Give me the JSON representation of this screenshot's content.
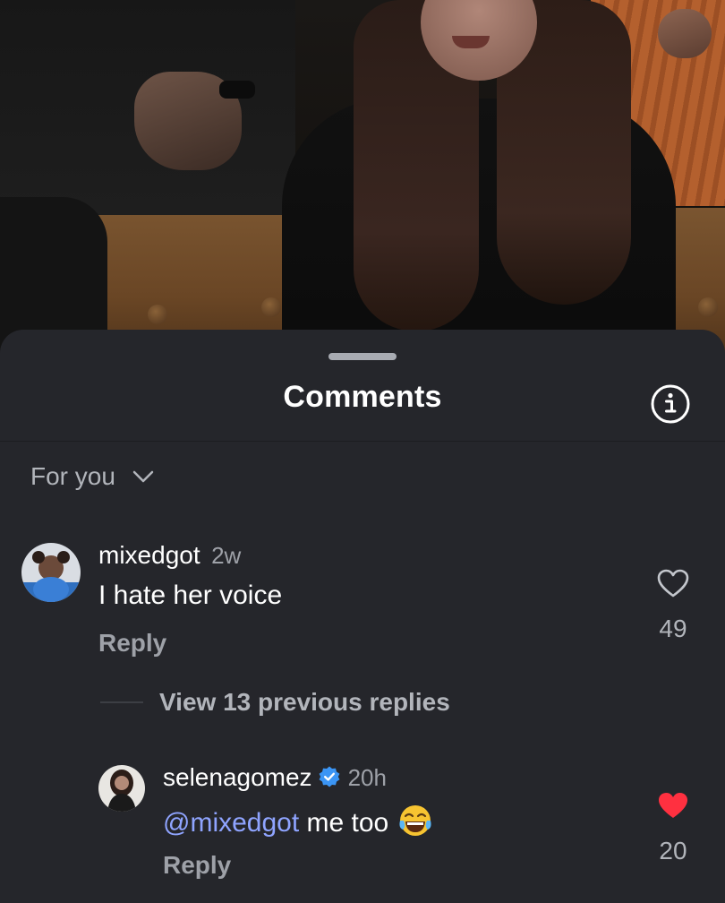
{
  "sheet": {
    "title": "Comments",
    "filter_label": "For you"
  },
  "icons": {
    "info": "info-icon",
    "filter": "chevron-down-icon",
    "like": "heart-icon",
    "liked": "heart-filled-icon",
    "verified": "verified-badge-icon",
    "emoji": "tears-of-joy-emoji"
  },
  "colors": {
    "sheet_bg": "#25262b",
    "mention": "#8fa4ff",
    "liked": "#ff3040",
    "verified": "#3b95f5"
  },
  "comments": [
    {
      "username": "mixedgot",
      "time": "2w",
      "text": "I hate her voice",
      "reply_label": "Reply",
      "likes": "49",
      "liked": false
    }
  ],
  "replies_toggle": "View 13 previous replies",
  "replies": [
    {
      "username": "selenagomez",
      "verified": true,
      "time": "20h",
      "mention": "@mixedgot",
      "text": "me too",
      "reply_label": "Reply",
      "likes": "20",
      "liked": true
    }
  ]
}
